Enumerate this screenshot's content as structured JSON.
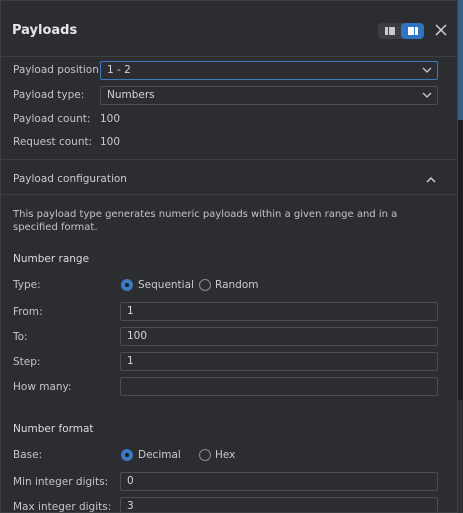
{
  "panel": {
    "title": "Payloads"
  },
  "payload_sets": {
    "position_label": "Payload position:",
    "position_value": "1 - 2",
    "type_label": "Payload type:",
    "type_value": "Numbers",
    "count_label": "Payload count:",
    "count_value": "100",
    "request_label": "Request count:",
    "request_value": "100"
  },
  "config": {
    "section_title": "Payload configuration",
    "description": "This payload type generates numeric payloads within a given range and in a specified format.",
    "number_range": {
      "title": "Number range",
      "type_label": "Type:",
      "type_options": [
        "Sequential",
        "Random"
      ],
      "type_selected": "Sequential",
      "from_label": "From:",
      "from_value": "1",
      "to_label": "To:",
      "to_value": "100",
      "step_label": "Step:",
      "step_value": "1",
      "howmany_label": "How many:",
      "howmany_value": ""
    },
    "number_format": {
      "title": "Number format",
      "base_label": "Base:",
      "base_options": [
        "Decimal",
        "Hex"
      ],
      "base_selected": "Decimal",
      "min_int_label": "Min integer digits:",
      "min_int_value": "0",
      "max_int_label": "Max integer digits:",
      "max_int_value": "3"
    }
  },
  "icons": {
    "layout_toggle": [
      "list-layout-icon",
      "split-layout-icon"
    ],
    "close": "close-icon",
    "dropdown": "chevron-down-icon",
    "collapse": "chevron-up-icon"
  },
  "colors": {
    "accent": "#3d79c2",
    "panel_bg": "#2b2d30",
    "text": "#c9cbcf"
  }
}
